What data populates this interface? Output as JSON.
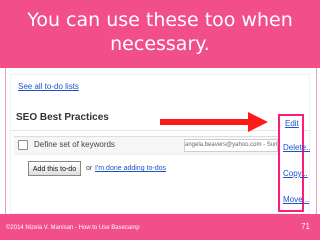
{
  "slide": {
    "title": "You can use these too when necessary.",
    "footer_text": "©2014 Nizela V. Manisan - How to Use Basecamp",
    "page_number": "71",
    "accent_color": "#f24e8a",
    "highlight_color": "#ff1b7c"
  },
  "screenshot": {
    "see_all_link": "See all to-do lists",
    "list_title": "SEO Best Practices",
    "task": {
      "label": "Define set of keywords",
      "assignee_date": "angela.beavers@yahoo.com - Sun, Jul 28"
    },
    "add_button": "Add this to-do",
    "or_text": "or",
    "done_link": "I'm done adding to-dos",
    "actions": [
      "Edit",
      "Delete...",
      "Copy...",
      "Move..."
    ]
  },
  "icons": {
    "arrow": "red-arrow-icon",
    "checkbox": "checkbox-icon"
  }
}
